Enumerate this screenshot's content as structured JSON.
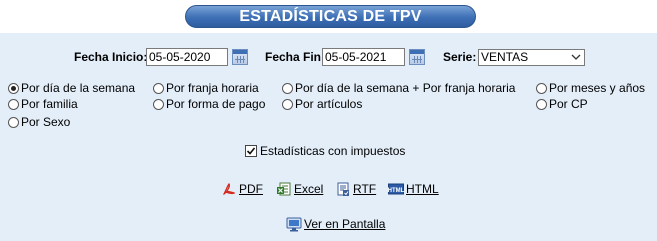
{
  "title": "ESTADÍSTICAS DE TPV",
  "filters": {
    "fecha_inicio_label": "Fecha Inicio:",
    "fecha_inicio_value": "05-05-2020",
    "fecha_fin_label": "Fecha Fin:",
    "fecha_fin_value": "05-05-2021",
    "serie_label": "Serie:",
    "serie_value": "VENTAS"
  },
  "options": [
    {
      "label": "Por día de la semana",
      "checked": true
    },
    {
      "label": "Por franja horaria",
      "checked": false
    },
    {
      "label": "Por día de la semana + Por franja horaria",
      "checked": false
    },
    {
      "label": "Por meses y años",
      "checked": false
    },
    {
      "label": "Por familia",
      "checked": false
    },
    {
      "label": "Por forma de pago",
      "checked": false
    },
    {
      "label": "Por artículos",
      "checked": false
    },
    {
      "label": "Por CP",
      "checked": false
    },
    {
      "label": "Por Sexo",
      "checked": false
    }
  ],
  "impuestos": {
    "label": "Estadísticas con impuestos",
    "checked": true
  },
  "exports": {
    "pdf": "PDF",
    "excel": "Excel",
    "rtf": "RTF",
    "html": "HTML"
  },
  "ver_en_pantalla": "Ver en Pantalla",
  "colors": {
    "panel_bg": "#e4eef9",
    "title_bar": "#3d6fb5",
    "title_text": "#ffffff"
  }
}
